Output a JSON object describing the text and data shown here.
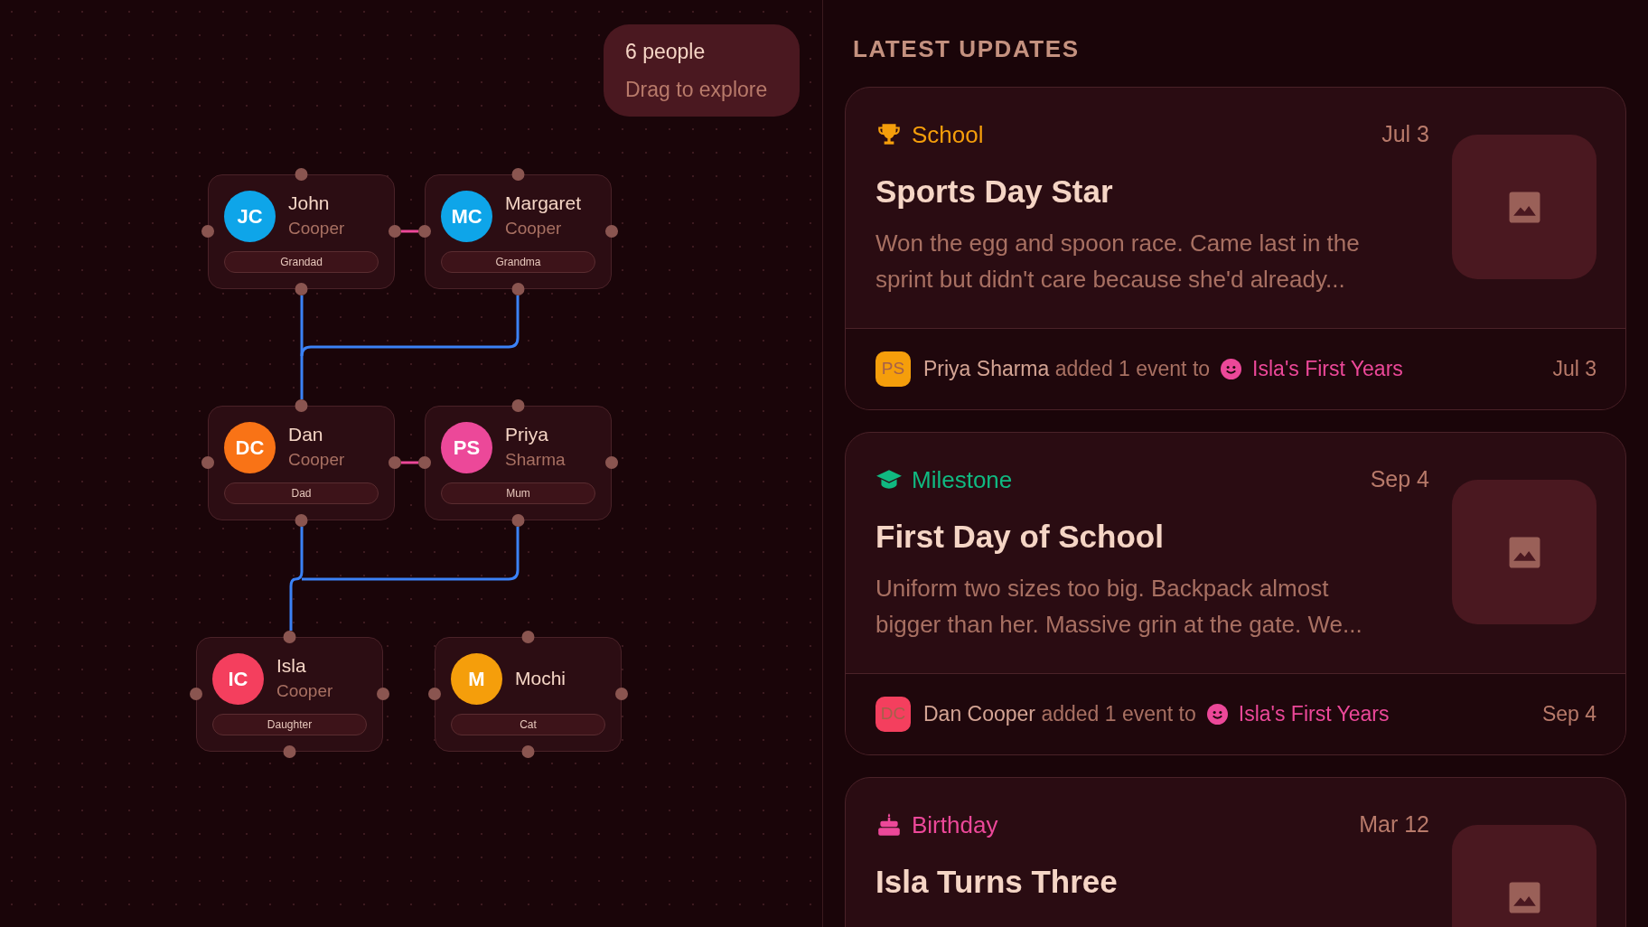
{
  "summary": {
    "count": "6 people",
    "hint": "Drag to explore"
  },
  "people": [
    {
      "initials": "JC",
      "first_name": "John",
      "last_name": "Cooper",
      "role": "Grandad",
      "color": "#0ea5e9"
    },
    {
      "initials": "MC",
      "first_name": "Margaret",
      "last_name": "Cooper",
      "role": "Grandma",
      "color": "#0ea5e9"
    },
    {
      "initials": "DC",
      "first_name": "Dan",
      "last_name": "Cooper",
      "role": "Dad",
      "color": "#f97316"
    },
    {
      "initials": "PS",
      "first_name": "Priya",
      "last_name": "Sharma",
      "role": "Mum",
      "color": "#ec4899"
    },
    {
      "initials": "IC",
      "first_name": "Isla",
      "last_name": "Cooper",
      "role": "Daughter",
      "color": "#f43f5e"
    },
    {
      "initials": "M",
      "first_name": "Mochi",
      "role": "Cat",
      "color": "#f59e0b"
    }
  ],
  "updates": {
    "heading": "LATEST UPDATES",
    "items": [
      {
        "category": "School",
        "kind": "trophy",
        "color": "#f59e0b",
        "date": "Jul 3",
        "title": "Sports Day Star",
        "body": "Won the egg and spoon race. Came last in the sprint but didn't care because she'd already...",
        "footer": {
          "initials": "PS",
          "color": "#f59e0b",
          "author": "Priya Sharma",
          "action": "added 1 event to",
          "album": "Isla's First Years",
          "date": "Jul 3"
        }
      },
      {
        "category": "Milestone",
        "kind": "graduation",
        "color": "#10b981",
        "date": "Sep 4",
        "title": "First Day of School",
        "body": "Uniform two sizes too big. Backpack almost bigger than her. Massive grin at the gate. We...",
        "footer": {
          "initials": "DC",
          "color": "#f43f5e",
          "author": "Dan Cooper",
          "action": "added 1 event to",
          "album": "Isla's First Years",
          "date": "Sep 4"
        }
      },
      {
        "category": "Birthday",
        "kind": "cake",
        "color": "#ec4899",
        "date": "Mar 12",
        "title": "Isla Turns Three"
      }
    ]
  }
}
